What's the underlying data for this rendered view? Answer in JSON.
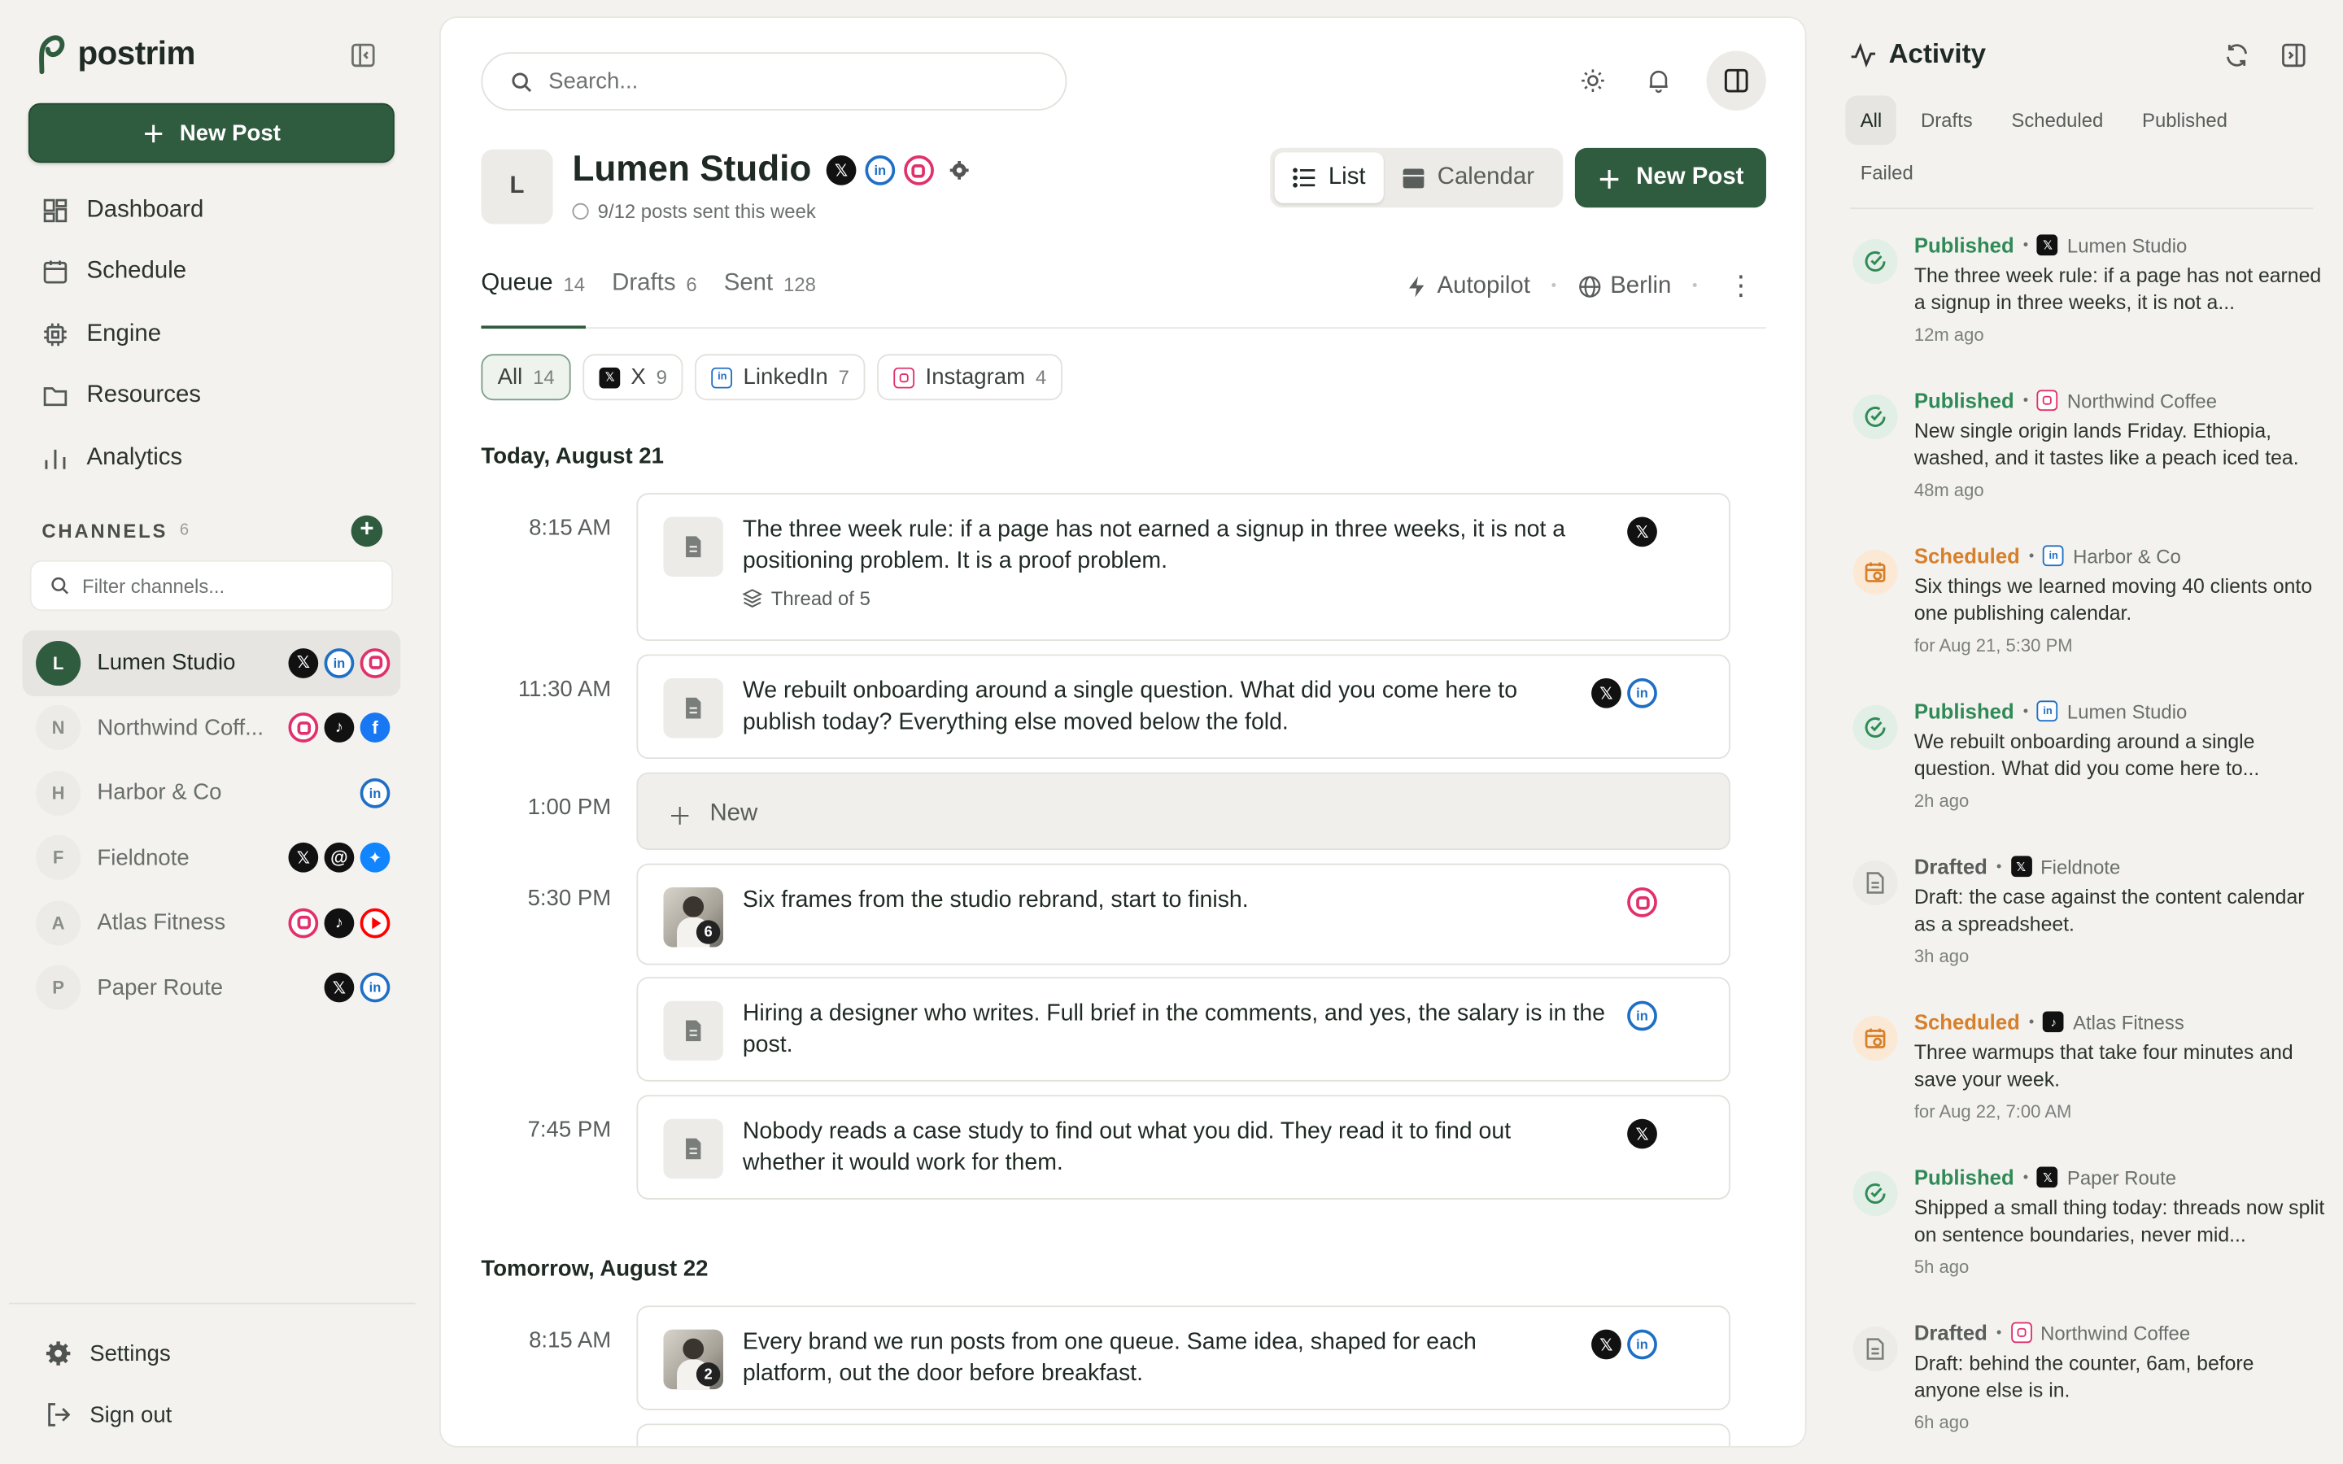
{
  "brand": {
    "name": "postrim"
  },
  "sidebar": {
    "new_post": "New Post",
    "nav": [
      {
        "label": "Dashboard",
        "icon": "dashboard-icon"
      },
      {
        "label": "Schedule",
        "icon": "calendar-icon"
      },
      {
        "label": "Engine",
        "icon": "chip-icon"
      },
      {
        "label": "Resources",
        "icon": "folder-icon"
      },
      {
        "label": "Analytics",
        "icon": "bar-chart-icon"
      }
    ],
    "channels_title": "CHANNELS",
    "channels_count": "6",
    "filter_placeholder": "Filter channels...",
    "channels": [
      {
        "initial": "L",
        "name": "Lumen Studio",
        "networks": [
          "x",
          "linkedin",
          "instagram"
        ],
        "active": true
      },
      {
        "initial": "N",
        "name": "Northwind Coff...",
        "networks": [
          "instagram",
          "tiktok",
          "facebook"
        ]
      },
      {
        "initial": "H",
        "name": "Harbor & Co",
        "networks": [
          "linkedin"
        ]
      },
      {
        "initial": "F",
        "name": "Fieldnote",
        "networks": [
          "x",
          "threads",
          "bluesky"
        ]
      },
      {
        "initial": "A",
        "name": "Atlas Fitness",
        "networks": [
          "instagram",
          "tiktok",
          "youtube"
        ]
      },
      {
        "initial": "P",
        "name": "Paper Route",
        "networks": [
          "x",
          "linkedin"
        ]
      }
    ],
    "settings": "Settings",
    "sign_out": "Sign out"
  },
  "topbar": {
    "search_placeholder": "Search..."
  },
  "profile": {
    "initial": "L",
    "name": "Lumen Studio",
    "subtitle": "9/12 posts sent this week"
  },
  "view_toggle": {
    "list": "List",
    "calendar": "Calendar"
  },
  "new_post_main": "New Post",
  "tabs": [
    {
      "label": "Queue",
      "count": "14"
    },
    {
      "label": "Drafts",
      "count": "6"
    },
    {
      "label": "Sent",
      "count": "128"
    }
  ],
  "tab_right": {
    "autopilot": "Autopilot",
    "timezone": "Berlin"
  },
  "filters": [
    {
      "label": "All",
      "count": "14"
    },
    {
      "label": "X",
      "count": "9"
    },
    {
      "label": "LinkedIn",
      "count": "7"
    },
    {
      "label": "Instagram",
      "count": "4"
    }
  ],
  "days": [
    {
      "heading": "Today, August 21"
    },
    {
      "heading": "Tomorrow, August 22"
    }
  ],
  "slots": [
    {
      "time": "8:15 AM",
      "text": "The three week rule: if a page has not earned a signup in three weeks, it is not a positioning problem. It is a proof problem.",
      "meta": "Thread of 5"
    },
    {
      "time": "11:30 AM",
      "text": "We rebuilt onboarding around a single question. What did you come here to publish today? Everything else moved below the fold."
    },
    {
      "time": "1:00 PM",
      "new_label": "New"
    },
    {
      "time": "5:30 PM",
      "text": "Six frames from the studio rebrand, start to finish.",
      "badge": "6"
    },
    {
      "time": "",
      "text": "Hiring a designer who writes. Full brief in the comments, and yes, the salary is in the post."
    },
    {
      "time": "7:45 PM",
      "text": "Nobody reads a case study to find out what you did. They read it to find out whether it would work for them."
    },
    {
      "time": "8:15 AM",
      "text": "Every brand we run posts from one queue. Same idea, shaped for each platform, out the door before breakfast.",
      "badge": "2"
    }
  ],
  "activity": {
    "title": "Activity",
    "tabs": [
      "All",
      "Drafts",
      "Scheduled",
      "Published",
      "Failed"
    ],
    "items": [
      {
        "status": "Published",
        "channel": "Lumen Studio",
        "network": "x",
        "text": "The three week rule: if a page has not earned a signup in three weeks, it is not a...",
        "time": "12m ago"
      },
      {
        "status": "Published",
        "channel": "Northwind Coffee",
        "network": "instagram",
        "text": "New single origin lands Friday. Ethiopia, washed, and it tastes like a peach iced tea.",
        "time": "48m ago"
      },
      {
        "status": "Scheduled",
        "channel": "Harbor & Co",
        "network": "linkedin",
        "text": "Six things we learned moving 40 clients onto one publishing calendar.",
        "time": "for Aug 21, 5:30 PM"
      },
      {
        "status": "Published",
        "channel": "Lumen Studio",
        "network": "linkedin",
        "text": "We rebuilt onboarding around a single question. What did you come here to...",
        "time": "2h ago"
      },
      {
        "status": "Drafted",
        "channel": "Fieldnote",
        "network": "x",
        "text": "Draft: the case against the content calendar as a spreadsheet.",
        "time": "3h ago"
      },
      {
        "status": "Scheduled",
        "channel": "Atlas Fitness",
        "network": "tiktok",
        "text": "Three warmups that take four minutes and save your week.",
        "time": "for Aug 22, 7:00 AM"
      },
      {
        "status": "Published",
        "channel": "Paper Route",
        "network": "x",
        "text": "Shipped a small thing today: threads now split on sentence boundaries, never mid...",
        "time": "5h ago"
      },
      {
        "status": "Drafted",
        "channel": "Northwind Coffee",
        "network": "instagram",
        "text": "Draft: behind the counter, 6am, before anyone else is in.",
        "time": "6h ago"
      }
    ]
  },
  "colors": {
    "brand": "#2f5b3e",
    "published": "#2f8a56",
    "scheduled": "#d7802c",
    "background": "#f3f2ef"
  }
}
